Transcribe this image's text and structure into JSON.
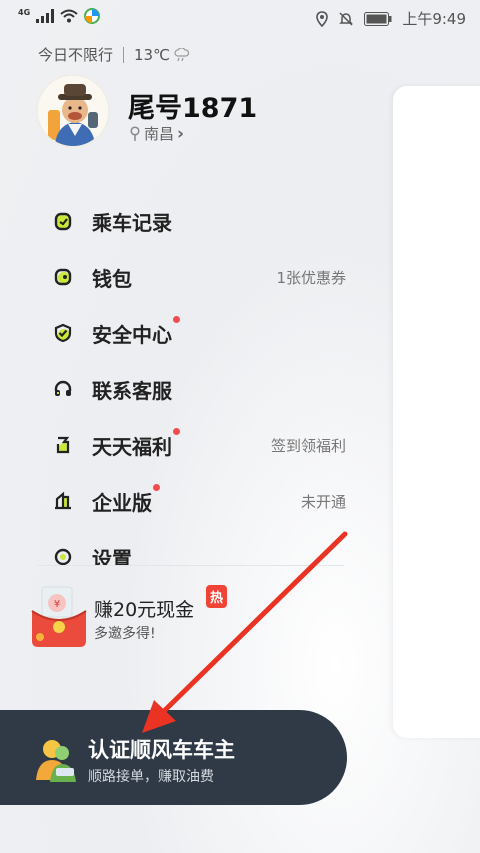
{
  "status_bar": {
    "network": "4G",
    "time": "上午9:49"
  },
  "header": {
    "restriction": "今日不限行",
    "temperature": "13℃",
    "weather_icon": "cloud-rain-icon"
  },
  "user": {
    "title": "尾号1871",
    "city": "南昌",
    "chevron": "›"
  },
  "menu": {
    "items": [
      {
        "label": "乘车记录",
        "icon": "trip-record-icon",
        "right": "",
        "dot": false
      },
      {
        "label": "钱包",
        "icon": "wallet-icon",
        "right": "1张优惠券",
        "dot": false
      },
      {
        "label": "安全中心",
        "icon": "shield-check-icon",
        "right": "",
        "dot": true
      },
      {
        "label": "联系客服",
        "icon": "headset-icon",
        "right": "",
        "dot": false
      },
      {
        "label": "天天福利",
        "icon": "gift-icon",
        "right": "签到领福利",
        "dot": true
      },
      {
        "label": "企业版",
        "icon": "building-icon",
        "right": "未开通",
        "dot": true
      },
      {
        "label": "设置",
        "icon": "settings-icon",
        "right": "",
        "dot": false
      }
    ]
  },
  "promo": {
    "title": "赚20元现金",
    "subtitle": "多邀多得!",
    "badge": "热"
  },
  "driver_banner": {
    "title": "认证顺风车车主",
    "subtitle": "顺路接单，赚取油费"
  },
  "colors": {
    "accent_green": "#c9e83a",
    "dot_red": "#f24c4c",
    "banner_bg": "#2f3a46",
    "arrow_red": "#ea3323"
  }
}
